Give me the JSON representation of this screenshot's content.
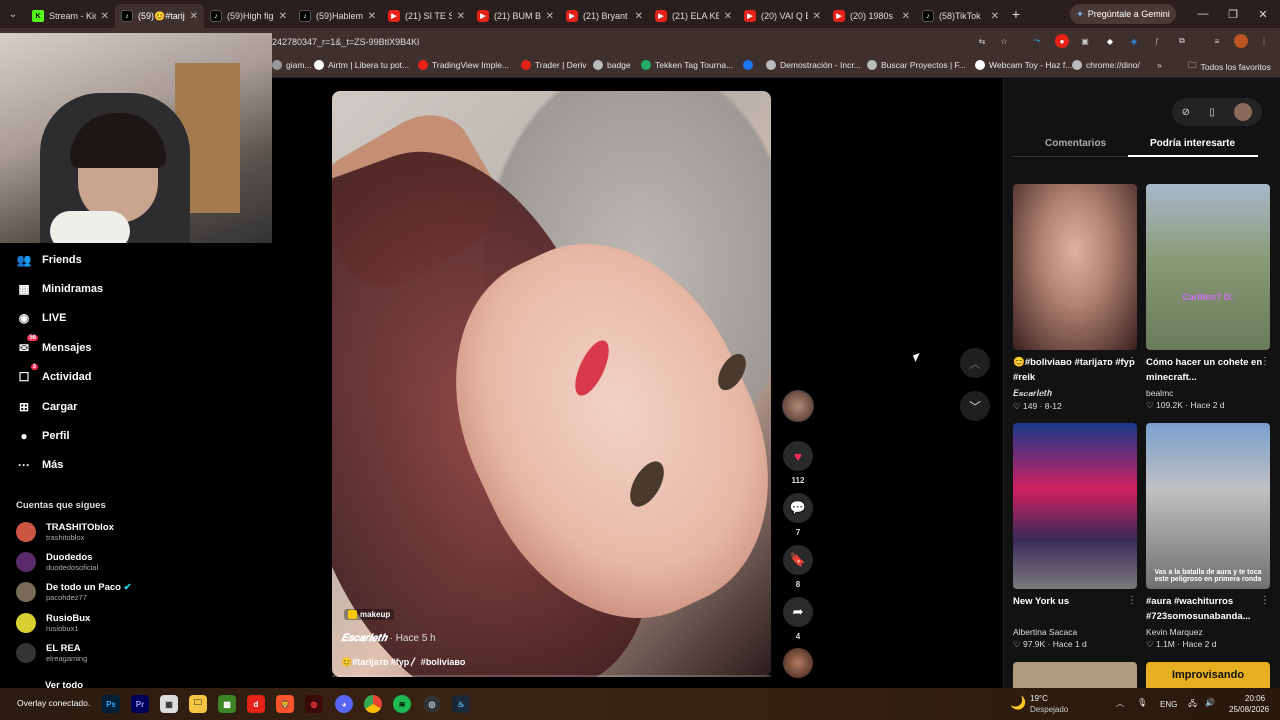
{
  "browser": {
    "tabs": [
      {
        "title": "Stream - Kic",
        "icon": "kick",
        "active": false
      },
      {
        "title": "(59)😊#tarij",
        "icon": "tiktok",
        "active": true
      },
      {
        "title": "(59)High fig",
        "icon": "tiktok",
        "active": false
      },
      {
        "title": "(59)Hablem",
        "icon": "tiktok",
        "active": false
      },
      {
        "title": "(21) SI TE S",
        "icon": "youtube",
        "active": false
      },
      {
        "title": "(21) BUM B",
        "icon": "youtube",
        "active": false
      },
      {
        "title": "(21) Bryant",
        "icon": "youtube",
        "active": false
      },
      {
        "title": "(21) ELA KE",
        "icon": "youtube",
        "active": false
      },
      {
        "title": "(20) VAI Q E",
        "icon": "youtube",
        "active": false
      },
      {
        "title": "(20) 1980s",
        "icon": "youtube",
        "active": false
      },
      {
        "title": "(58)TikTok",
        "icon": "tiktok",
        "active": false
      }
    ],
    "new_tab": "+",
    "gemini_label": "Pregúntale a Gemini",
    "url": "242780347_r=1&_t=ZS-99BtlX9B4Kl",
    "bookmarks": [
      {
        "label": "giam...",
        "color": "#999"
      },
      {
        "label": "Airtm | Libera tu pot...",
        "color": "#fff"
      },
      {
        "label": "TradingView Imple...",
        "color": "#e62117"
      },
      {
        "label": "Trader | Deriv",
        "color": "#e62117"
      },
      {
        "label": "badge",
        "color": "#bbb"
      },
      {
        "label": "Tekken Tag Tourna...",
        "color": "#2a6"
      },
      {
        "label": "",
        "color": "#1877f2"
      },
      {
        "label": "Demostración - Incr...",
        "color": "#bbb"
      },
      {
        "label": "Buscar Proyectos | F...",
        "color": "#bbb"
      },
      {
        "label": "Webcam Toy - Haz f...",
        "color": "#fff"
      },
      {
        "label": "chrome://dino/",
        "color": "#bbb"
      }
    ],
    "more_bookmarks": "»",
    "all_bookmarks": "Todos los favoritos"
  },
  "sidebar": {
    "nav": [
      {
        "label": "Friends",
        "icon": "friends-icon",
        "glyph": "👥",
        "badge": ""
      },
      {
        "label": "Minidramas",
        "icon": "minidramas-icon",
        "glyph": "▦",
        "badge": ""
      },
      {
        "label": "LIVE",
        "icon": "live-icon",
        "glyph": "◉",
        "badge": ""
      },
      {
        "label": "Mensajes",
        "icon": "messages-icon",
        "glyph": "✉",
        "badge": "56"
      },
      {
        "label": "Actividad",
        "icon": "activity-icon",
        "glyph": "☐",
        "badge": "3"
      },
      {
        "label": "Cargar",
        "icon": "upload-icon",
        "glyph": "⊞",
        "badge": ""
      },
      {
        "label": "Perfil",
        "icon": "profile-icon",
        "glyph": "●",
        "badge": ""
      },
      {
        "label": "Más",
        "icon": "more-icon",
        "glyph": "···",
        "badge": ""
      }
    ],
    "following_header": "Cuentas que sigues",
    "following": [
      {
        "name": "TRASHITOblox",
        "handle": "trashitoblox",
        "color": "#c54"
      },
      {
        "name": "Duodedos",
        "handle": "duodedosoficial",
        "color": "#5a2a6a"
      },
      {
        "name": "De todo un Paco",
        "handle": "pacohdez77",
        "color": "#7a6a5a",
        "verified": true
      },
      {
        "name": "RusioBux",
        "handle": "rusiobux1",
        "color": "#d8d030"
      },
      {
        "name": "EL REA",
        "handle": "elreagaming",
        "color": "#333"
      }
    ],
    "see_all": "Ver todo"
  },
  "video": {
    "tag": "makeup",
    "author": "𝑬𝒔𝒄𝒂𝒓𝒍𝒆𝒕𝒉",
    "time": " · Hace 5 h",
    "description": "😊#tarijaᴛᴅ #fyp〳 #boliviaʙᴏ"
  },
  "actions": {
    "likes": "112",
    "comments": "7",
    "saves": "8",
    "shares": "4"
  },
  "right_panel": {
    "tabs": [
      "Comentarios",
      "Podría interesarte"
    ],
    "active_tab": 1,
    "cards": [
      {
        "title": "😊#boliviaʙᴏ #tarijaᴛᴅ #fyp #reik",
        "author": "𝑬𝒔𝒄𝒂𝒓𝒍𝒆𝒕𝒉",
        "likes": "149",
        "date": "8-12",
        "thumb_text": ""
      },
      {
        "title": "Cómo hacer un cohete en minecraft...",
        "author": "bealmc",
        "likes": "109.2K",
        "date": "Hace 2 d",
        "thumb_text": "Carlitos? D:"
      },
      {
        "title": "New York us",
        "author": "Albertina Sacaca",
        "likes": "97.9K",
        "date": "Hace 1 d",
        "thumb_text": ""
      },
      {
        "title": "#aura #wachiturros #723somosunabanda...",
        "author": "Kevin Marquez",
        "likes": "1.1M",
        "date": "Hace 2 d",
        "thumb_text": "Vas a la batalla de aura y te toca este peligroso en primera ronda"
      }
    ],
    "partial_card_text": "Improvisando"
  },
  "taskbar": {
    "overlay_text": "Overlay conectado.",
    "weather_temp": "19°C",
    "weather_desc": "Despejado",
    "language": "ENG",
    "time": "20:06",
    "date": "25/08/2026"
  }
}
